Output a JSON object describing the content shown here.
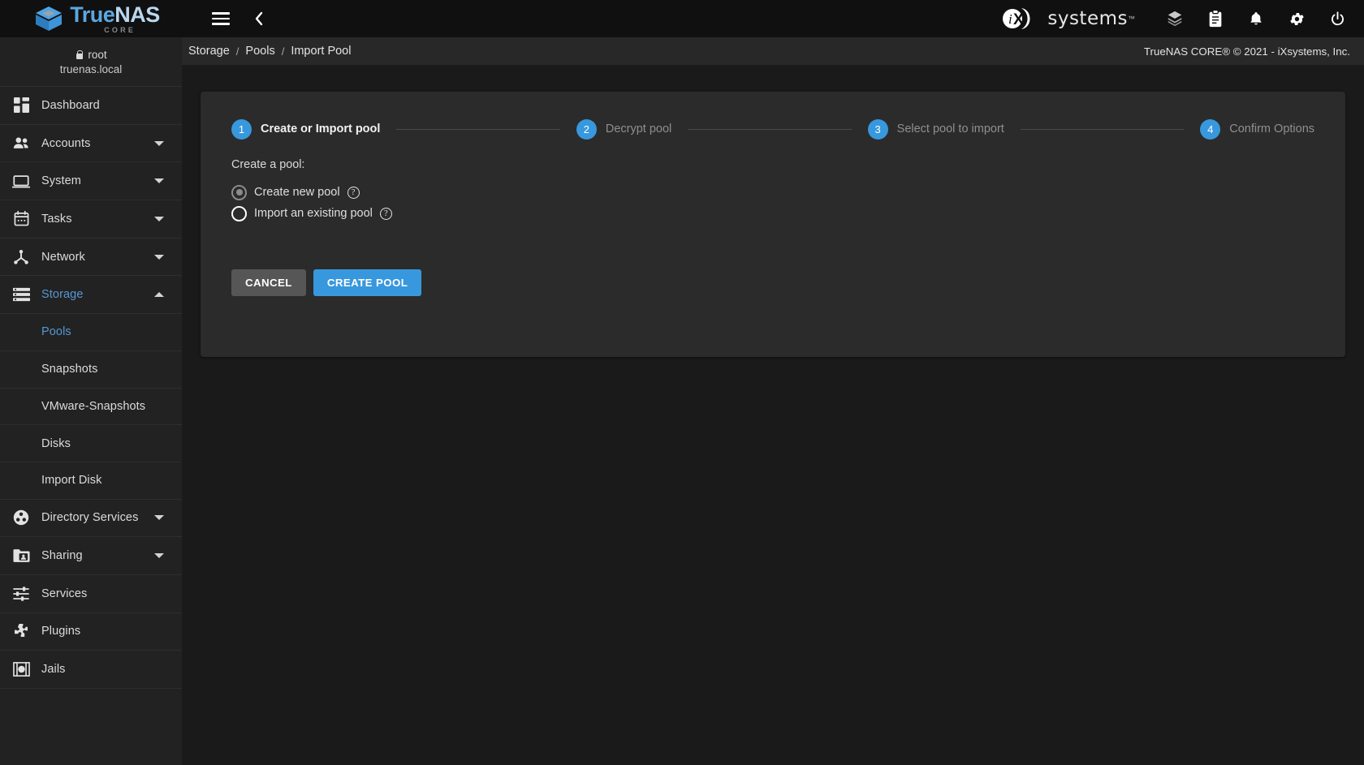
{
  "brand": {
    "name_true": "True",
    "name_nas": "NAS",
    "edition": "CORE",
    "logo_icon": "truenas-cube-logo"
  },
  "topbar": {
    "menu_icon": "hamburger-menu-icon",
    "back_icon": "chevron-left-icon",
    "vendor_logo": "ixsystems-logo",
    "vendor_name": "systems",
    "vendor_tm": "™",
    "icons": [
      {
        "name": "jobs-manager-icon",
        "glyph": "cube-layers"
      },
      {
        "name": "task-manager-icon",
        "glyph": "clipboard"
      },
      {
        "name": "notifications-icon",
        "glyph": "bell"
      },
      {
        "name": "settings-icon",
        "glyph": "gear"
      },
      {
        "name": "power-icon",
        "glyph": "power"
      }
    ]
  },
  "sidebar": {
    "user": {
      "lock_icon": "lock-icon",
      "name": "root",
      "hostname": "truenas.local"
    },
    "items": [
      {
        "label": "Dashboard",
        "icon": "dashboard-icon",
        "expandable": false,
        "active": false
      },
      {
        "label": "Accounts",
        "icon": "accounts-people-icon",
        "expandable": true,
        "active": false
      },
      {
        "label": "System",
        "icon": "system-monitor-icon",
        "expandable": true,
        "active": false
      },
      {
        "label": "Tasks",
        "icon": "tasks-calendar-icon",
        "expandable": true,
        "active": false
      },
      {
        "label": "Network",
        "icon": "network-nodes-icon",
        "expandable": true,
        "active": false
      },
      {
        "label": "Storage",
        "icon": "storage-list-icon",
        "expandable": true,
        "active": true,
        "expanded": true
      },
      {
        "label": "Directory Services",
        "icon": "directory-services-icon",
        "expandable": true,
        "active": false
      },
      {
        "label": "Sharing",
        "icon": "sharing-folder-icon",
        "expandable": true,
        "active": false
      },
      {
        "label": "Services",
        "icon": "services-sliders-icon",
        "expandable": false,
        "active": false
      },
      {
        "label": "Plugins",
        "icon": "plugins-puzzle-icon",
        "expandable": false,
        "active": false
      },
      {
        "label": "Jails",
        "icon": "jails-icon",
        "expandable": false,
        "active": false
      }
    ],
    "storage_children": [
      {
        "label": "Pools",
        "active": true
      },
      {
        "label": "Snapshots",
        "active": false
      },
      {
        "label": "VMware-Snapshots",
        "active": false
      },
      {
        "label": "Disks",
        "active": false
      },
      {
        "label": "Import Disk",
        "active": false
      }
    ]
  },
  "breadcrumb": {
    "items": [
      "Storage",
      "Pools",
      "Import Pool"
    ],
    "separator": "/"
  },
  "copyright": "TrueNAS CORE® © 2021 - iXsystems, Inc.",
  "wizard": {
    "steps": [
      {
        "number": "1",
        "label": "Create or Import pool",
        "active": true
      },
      {
        "number": "2",
        "label": "Decrypt pool",
        "active": false
      },
      {
        "number": "3",
        "label": "Select pool to import",
        "active": false
      },
      {
        "number": "4",
        "label": "Confirm Options",
        "active": false
      }
    ],
    "form": {
      "title": "Create a pool:",
      "options": [
        {
          "label": "Create new pool",
          "selected": true,
          "help_icon": "help-circle-icon",
          "help_glyph": "?"
        },
        {
          "label": "Import an existing pool",
          "selected": false,
          "help_icon": "help-circle-icon",
          "help_glyph": "?"
        }
      ],
      "buttons": {
        "cancel": "CANCEL",
        "submit": "CREATE POOL"
      }
    }
  },
  "colors": {
    "accent": "#3898dd",
    "topbar_bg": "#101010",
    "sidebar_bg": "#222222",
    "content_bg": "#1a1a1a",
    "card_bg": "#2b2b2b",
    "cancel_btn": "#565656"
  }
}
